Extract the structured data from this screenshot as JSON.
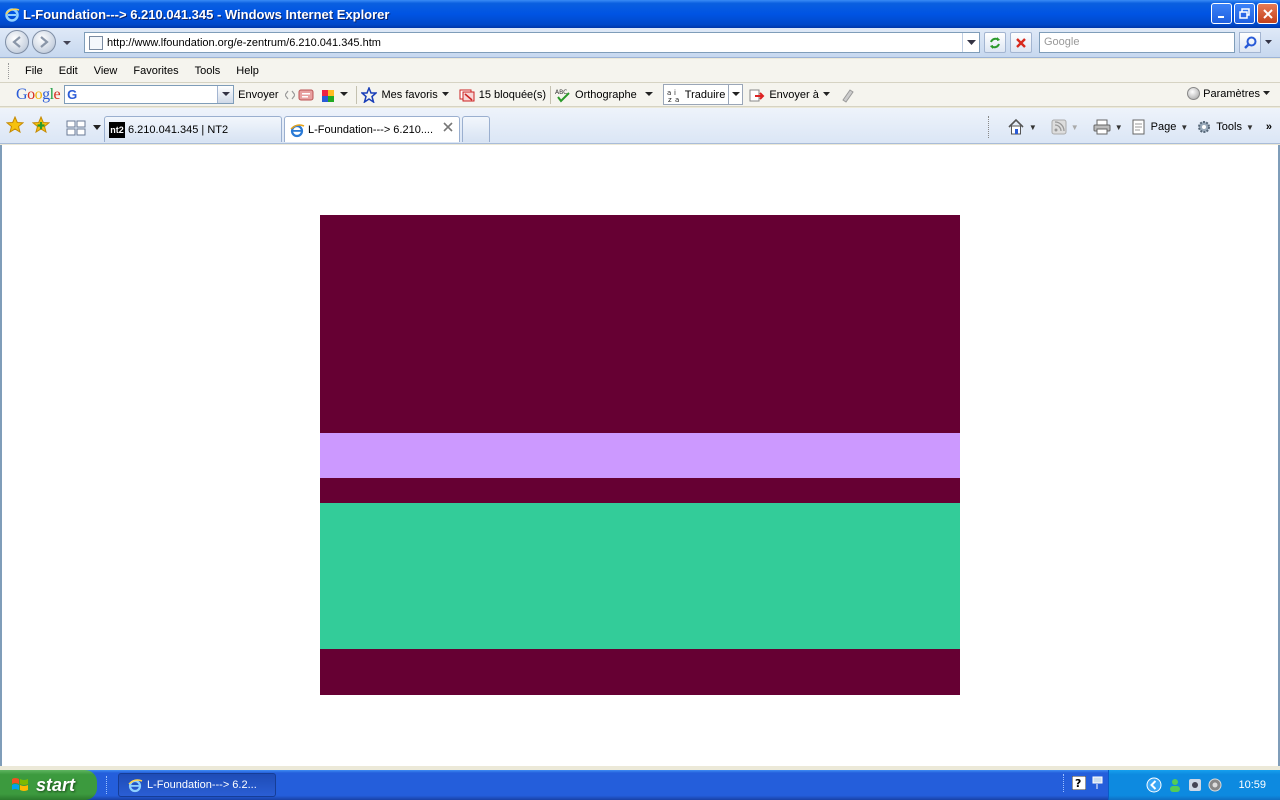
{
  "window": {
    "title": "L-Foundation---> 6.210.041.345 - Windows Internet Explorer"
  },
  "address_bar": {
    "url": "http://www.lfoundation.org/e-zentrum/6.210.041.345.htm",
    "search_placeholder": "Google"
  },
  "menu": {
    "items": [
      "File",
      "Edit",
      "View",
      "Favorites",
      "Tools",
      "Help"
    ]
  },
  "google_toolbar": {
    "logo": [
      "G",
      "o",
      "o",
      "g",
      "l",
      "e"
    ],
    "send_label": "Envoyer",
    "favorites_label": "Mes favoris",
    "blocked_label": "15 bloquée(s)",
    "spellcheck_label": "Orthographe",
    "translate_label": "Traduire",
    "sendto_label": "Envoyer à",
    "settings_label": "Paramètres"
  },
  "tabs": [
    {
      "label": "6.210.041.345 | NT2",
      "icon": "nt2",
      "active": false
    },
    {
      "label": "L-Foundation---> 6.210....",
      "icon": "ie-icon",
      "active": true
    }
  ],
  "command_bar": {
    "page_label": "Page",
    "tools_label": "Tools"
  },
  "flag": {
    "bands": [
      {
        "color": "#660033",
        "fraction": 0.455
      },
      {
        "color": "#cc99ff",
        "fraction": 0.094
      },
      {
        "color": "#660033",
        "fraction": 0.052
      },
      {
        "color": "#33cc99",
        "fraction": 0.304
      },
      {
        "color": "#660033",
        "fraction": 0.095
      }
    ]
  },
  "taskbar": {
    "start_label": "start",
    "task_label": "L-Foundation---> 6.2...",
    "clock": "10:59"
  }
}
